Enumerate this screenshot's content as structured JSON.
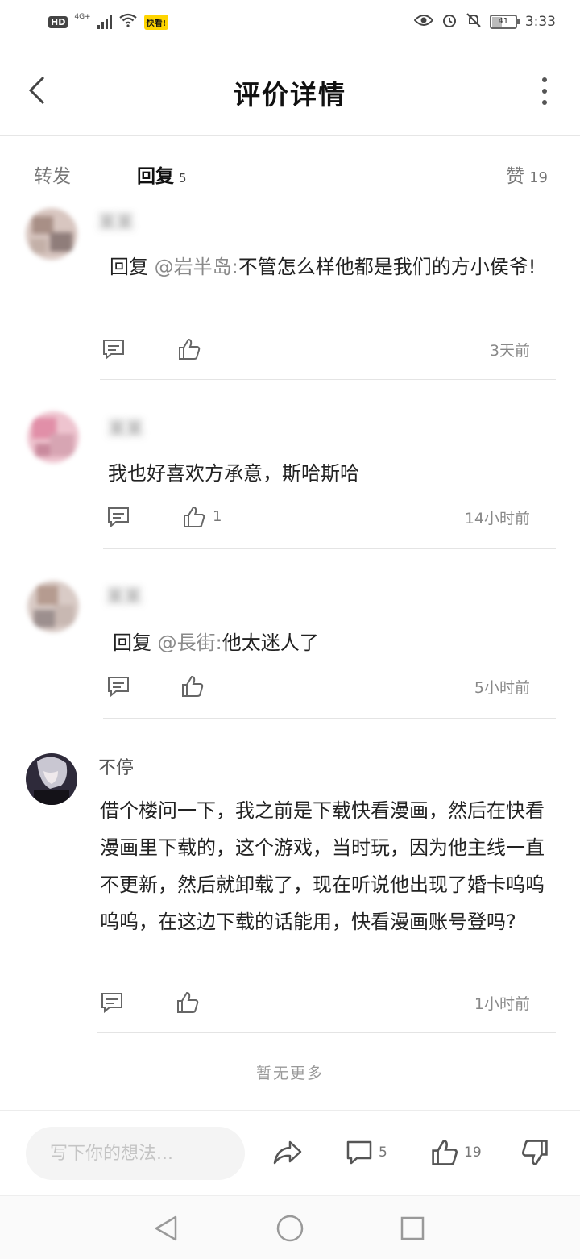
{
  "status_bar": {
    "hd_label": "HD",
    "network": "4G+",
    "app_badge": "快看!",
    "battery_level": "41",
    "time": "3:33"
  },
  "header": {
    "title": "评价详情"
  },
  "tabs": {
    "forward_label": "转发",
    "reply_label": "回复",
    "reply_count": "5",
    "like_label": "赞",
    "like_count": "19"
  },
  "comments": [
    {
      "username": "某某",
      "reply_prefix": "回复 ",
      "mention": "@岩半岛:",
      "text": "不管怎么样他都是我们的方小侯爷!",
      "likes": "",
      "time": "3天前",
      "avatar_color": "#c9aaa0"
    },
    {
      "username": "某某",
      "reply_prefix": "",
      "mention": "",
      "text": "我也好喜欢方承意，斯哈斯哈",
      "likes": "1",
      "time": "14小时前",
      "avatar_color": "#e4a7b8"
    },
    {
      "username": "某某",
      "reply_prefix": "回复 ",
      "mention": "@長街:",
      "text": "他太迷人了",
      "likes": "",
      "time": "5小时前",
      "avatar_color": "#b7a49c"
    },
    {
      "username": "不停",
      "reply_prefix": "",
      "mention": "",
      "text": "借个楼问一下，我之前是下载快看漫画，然后在快看漫画里下载的，这个游戏，当时玩，因为他主线一直不更新，然后就卸载了，现在听说他出现了婚卡呜呜呜呜，在这边下载的话能用，快看漫画账号登吗?",
      "likes": "",
      "time": "1小时前",
      "avatar_color": "#2e2a3a"
    }
  ],
  "footer_note": "暂无更多",
  "bottom_bar": {
    "input_placeholder": "写下你的想法...",
    "comment_count": "5",
    "like_count": "19"
  }
}
